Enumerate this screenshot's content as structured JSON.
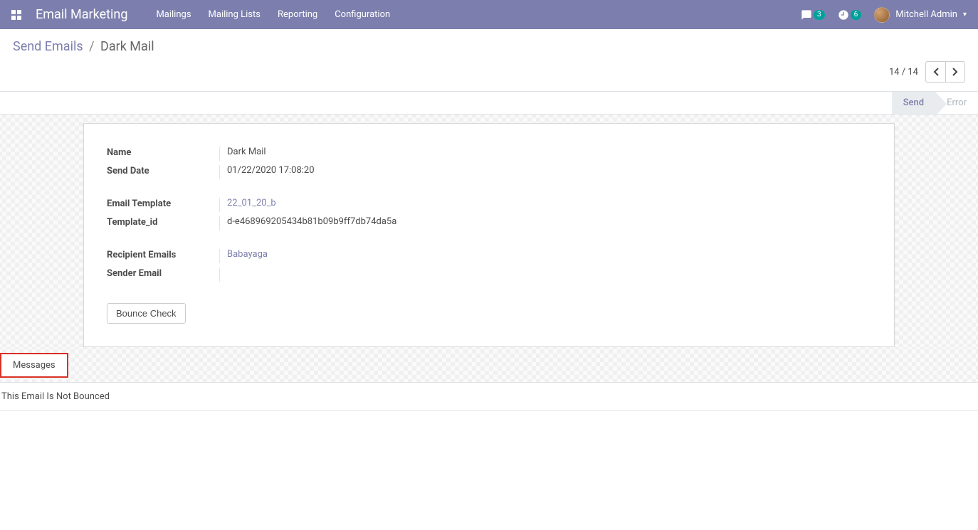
{
  "header": {
    "app_title": "Email Marketing",
    "nav": [
      "Mailings",
      "Mailing Lists",
      "Reporting",
      "Configuration"
    ],
    "discuss_badge": "3",
    "activity_badge": "6",
    "user_name": "Mitchell Admin"
  },
  "breadcrumb": {
    "parent": "Send Emails",
    "current": "Dark Mail"
  },
  "pager": {
    "text": "14 / 14"
  },
  "status": {
    "active": "Send",
    "inactive": "Error"
  },
  "form": {
    "group1": {
      "name_label": "Name",
      "name_value": "Dark Mail",
      "send_date_label": "Send Date",
      "send_date_value": "01/22/2020 17:08:20"
    },
    "group2": {
      "email_template_label": "Email Template",
      "email_template_value": "22_01_20_b",
      "template_id_label": "Template_id",
      "template_id_value": "d-e468969205434b81b09b9ff7db74da5a"
    },
    "group3": {
      "recipient_label": "Recipient Emails",
      "recipient_value": "Babayaga",
      "sender_label": "Sender Email",
      "sender_value": ""
    },
    "bounce_check_btn": "Bounce Check"
  },
  "messages": {
    "tab_label": "Messages",
    "content": "This Email Is Not Bounced"
  }
}
